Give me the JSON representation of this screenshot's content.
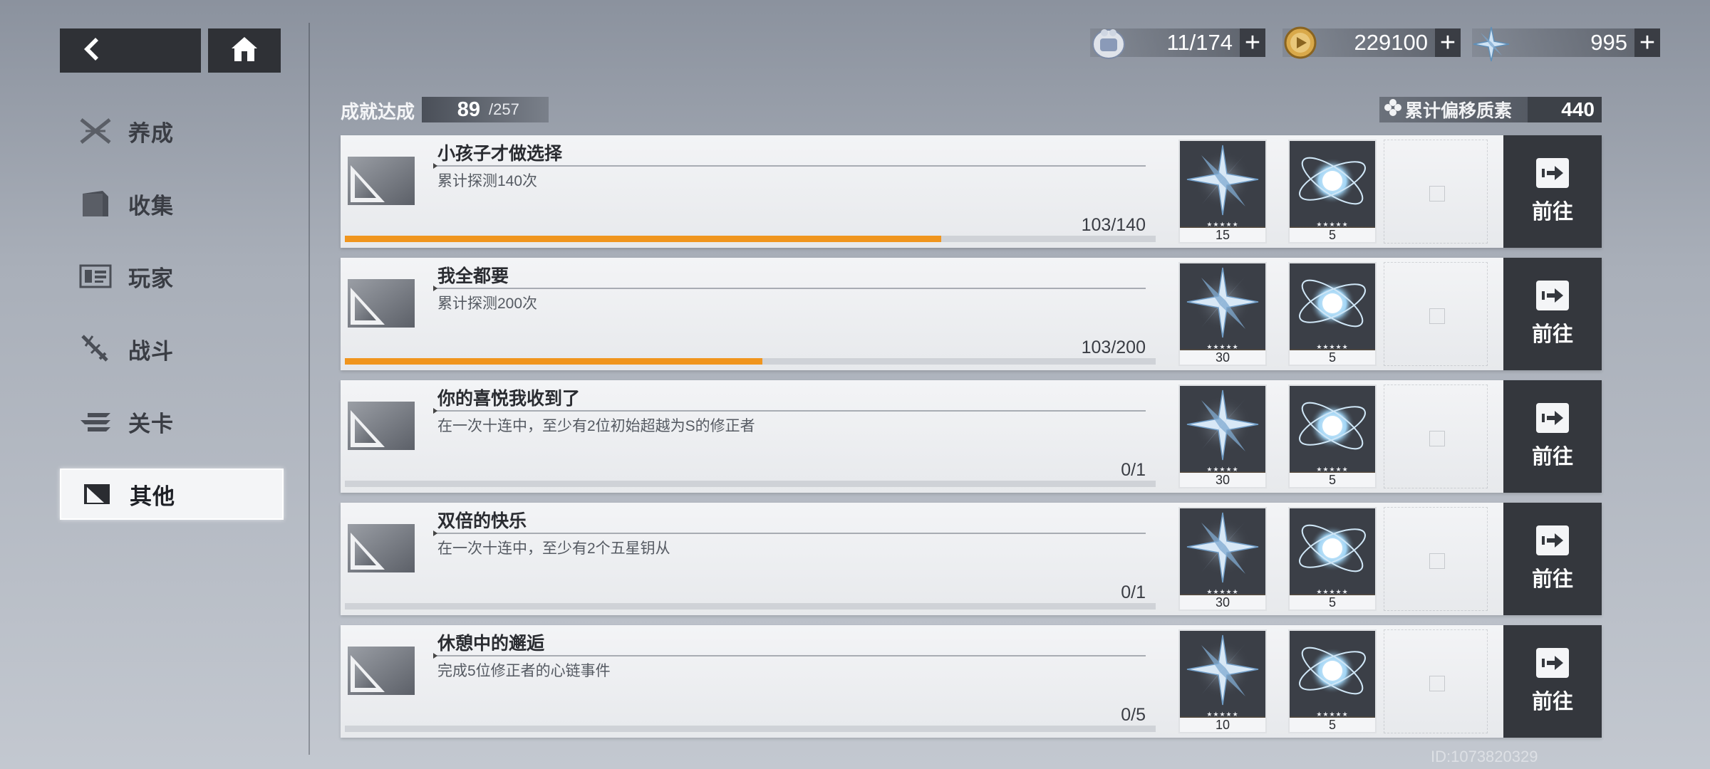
{
  "nav": {
    "back_icon": "chevron-left-icon",
    "home_icon": "home-icon"
  },
  "sidebar": {
    "items": [
      {
        "label": "养成",
        "icon": "crossed-blades-icon",
        "active": false
      },
      {
        "label": "收集",
        "icon": "folder-icon",
        "active": false
      },
      {
        "label": "玩家",
        "icon": "id-card-icon",
        "active": false
      },
      {
        "label": "战斗",
        "icon": "sword-icon",
        "active": false
      },
      {
        "label": "关卡",
        "icon": "flag-icon",
        "active": false
      },
      {
        "label": "其他",
        "icon": "corner-icon",
        "active": true
      }
    ]
  },
  "resources": {
    "stamina": {
      "value": "11/174",
      "icon": "stamina-icon"
    },
    "coins": {
      "value": "229100",
      "icon": "coin-icon"
    },
    "crystal": {
      "value": "995",
      "icon": "crystal-icon"
    }
  },
  "header": {
    "achievement_label": "成就达成",
    "achievement_current": "89",
    "achievement_total": "/257",
    "offset_label": "累计偏移质素",
    "offset_value": "440"
  },
  "achievements": [
    {
      "title": "小孩子才做选择",
      "desc": "累计探测140次",
      "progress_text": "103/140",
      "progress": 0.7357,
      "rewards": [
        "15",
        "5"
      ],
      "go_label": "前往"
    },
    {
      "title": "我全都要",
      "desc": "累计探测200次",
      "progress_text": "103/200",
      "progress": 0.515,
      "rewards": [
        "30",
        "5"
      ],
      "go_label": "前往"
    },
    {
      "title": "你的喜悦我收到了",
      "desc": "在一次十连中，至少有2位初始超越为S的修正者",
      "progress_text": "0/1",
      "progress": 0,
      "rewards": [
        "30",
        "5"
      ],
      "go_label": "前往"
    },
    {
      "title": "双倍的快乐",
      "desc": "在一次十连中，至少有2个五星钥从",
      "progress_text": "0/1",
      "progress": 0,
      "rewards": [
        "30",
        "5"
      ],
      "go_label": "前往"
    },
    {
      "title": "休憩中的邂逅",
      "desc": "完成5位修正者的心链事件",
      "progress_text": "0/5",
      "progress": 0,
      "rewards": [
        "10",
        "5"
      ],
      "go_label": "前往"
    }
  ],
  "colors": {
    "progress": "#f0951e",
    "dark_panel": "#34373d"
  },
  "footer": {
    "uid": "ID:1073820329"
  }
}
